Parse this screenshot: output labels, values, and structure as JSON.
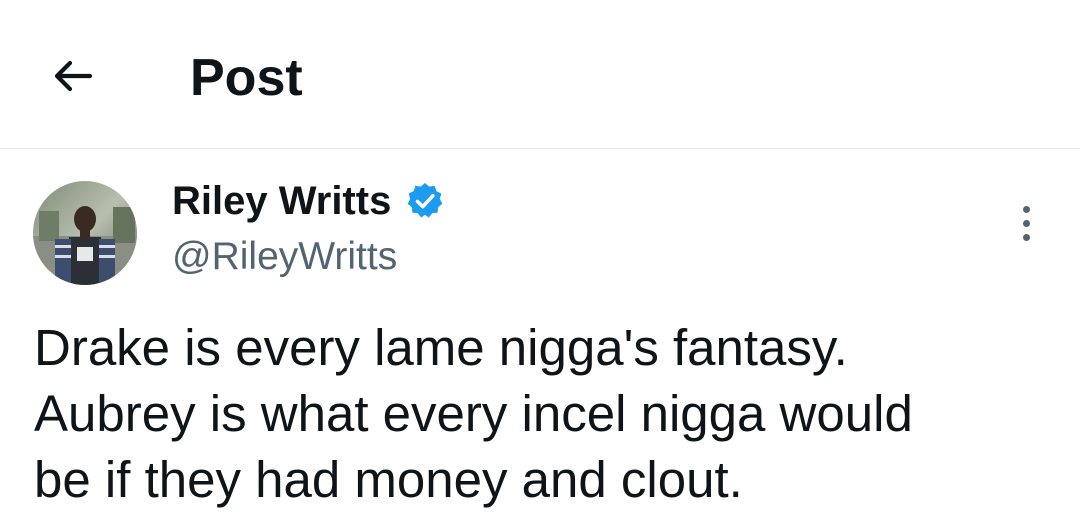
{
  "header": {
    "back_icon": "arrow-left-icon",
    "title": "Post"
  },
  "post": {
    "author": {
      "name": "Riley Writts",
      "handle": "@RileyWritts",
      "verified": true,
      "verified_icon": "verified-badge-icon",
      "verified_color": "#1d9bf0"
    },
    "more_icon": "more-vertical-icon",
    "text_lines": [
      "Drake is every lame nigga's fantasy.",
      "Aubrey is what every incel nigga would",
      "be if they had money and clout."
    ]
  },
  "colors": {
    "text_primary": "#0f1419",
    "text_secondary": "#536471",
    "divider": "#e6e8ea"
  }
}
